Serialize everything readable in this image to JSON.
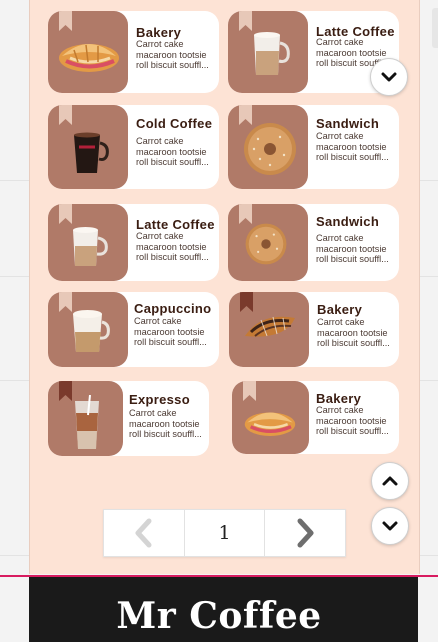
{
  "app": {
    "brand": "Mr Coffee"
  },
  "colors": {
    "panel": "#fde3d5",
    "thumb": "#b07a68",
    "footer": "#1a1a1a",
    "accent_line": "#d81b60"
  },
  "products": [
    {
      "name": "Bakery",
      "description": "Carrot cake macaroon tootsie roll biscuit souffl...",
      "image": "croissant-sandwich",
      "bookmark": "light"
    },
    {
      "name": "Latte Coffee",
      "description": "Carrot cake macaroon tootsie roll biscuit souffl...",
      "image": "latte-mug",
      "bookmark": "light"
    },
    {
      "name": "Cold Coffee",
      "description": "Carrot cake macaroon tootsie roll biscuit souffl...",
      "image": "black-coffee-cup",
      "bookmark": "light"
    },
    {
      "name": "Sandwich",
      "description": "Carrot cake macaroon tootsie roll biscuit souffl...",
      "image": "bagel-sandwich",
      "bookmark": "light"
    },
    {
      "name": "Latte Coffee",
      "description": "Carrot cake macaroon tootsie roll biscuit souffl...",
      "image": "latte-mug",
      "bookmark": "light"
    },
    {
      "name": "Sandwich",
      "description": "Carrot cake macaroon tootsie roll biscuit souffl...",
      "image": "bagel-sandwich",
      "bookmark": "light"
    },
    {
      "name": "Cappuccino",
      "description": "Carrot cake macaroon tootsie roll biscuit souffl...",
      "image": "cappuccino-cup",
      "bookmark": "light"
    },
    {
      "name": "Bakery",
      "description": "Carrot cake macaroon tootsie roll biscuit souffl...",
      "image": "chocolate-croissant",
      "bookmark": "dark"
    },
    {
      "name": "Expresso",
      "description": "Carrot cake macaroon tootsie roll biscuit souffl...",
      "image": "iced-coffee-glass",
      "bookmark": "dark"
    },
    {
      "name": "Bakery",
      "description": "Carrot cake macaroon tootsie roll biscuit souffl...",
      "image": "croissant-sandwich",
      "bookmark": "light"
    }
  ],
  "pagination": {
    "current_page": "1",
    "prev_icon": "chevron-left-icon",
    "next_icon": "chevron-right-icon"
  },
  "controls": {
    "scroll_up_icon": "chevron-up-icon",
    "scroll_down_icon": "chevron-down-icon"
  }
}
